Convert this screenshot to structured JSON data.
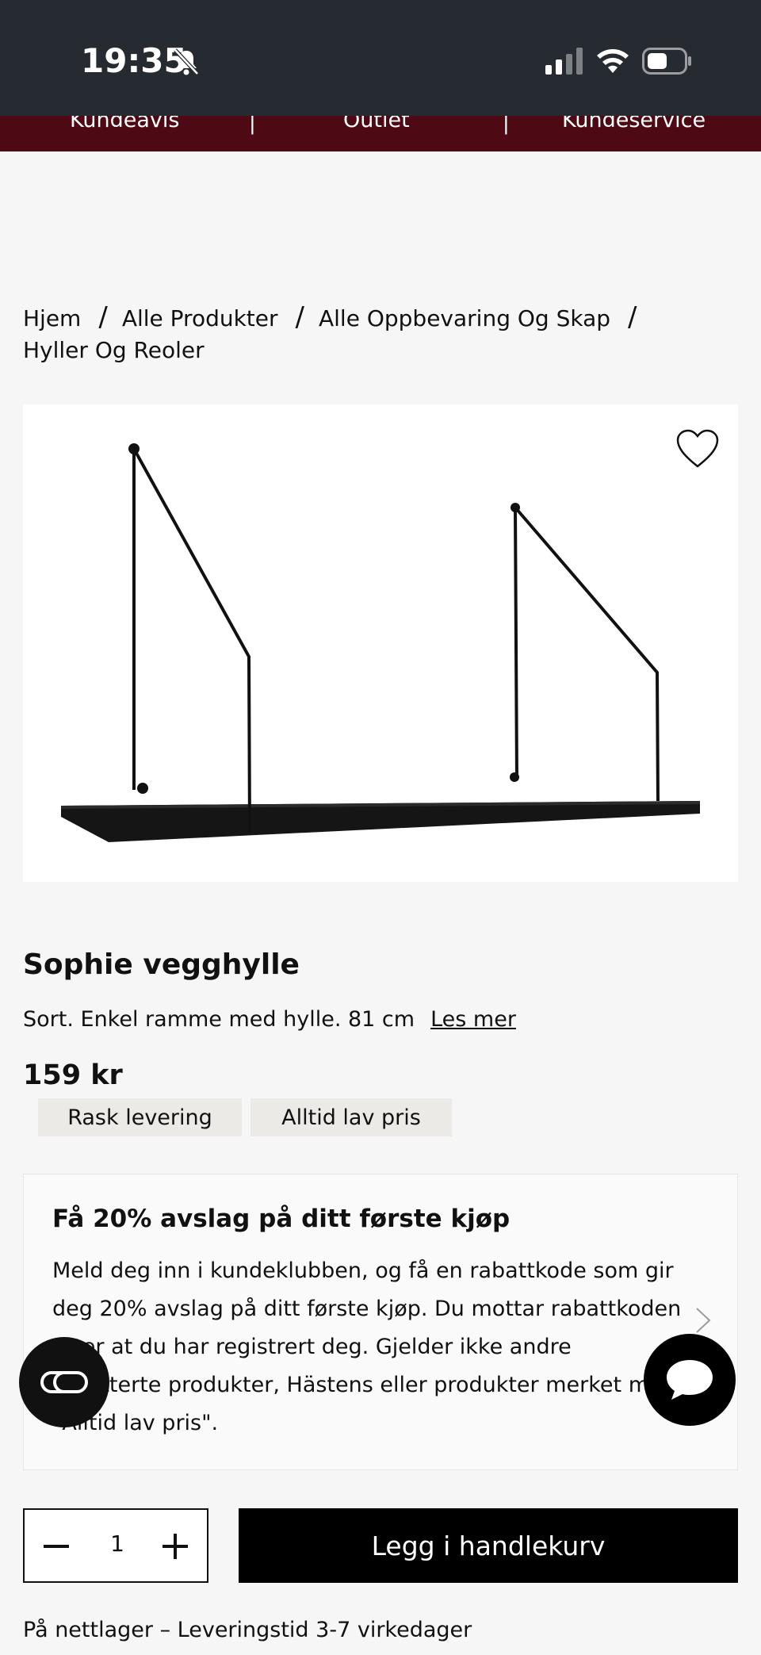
{
  "status_bar": {
    "time": "19:35"
  },
  "top_nav": {
    "items": [
      "Kundeavis",
      "Outlet",
      "Kundeservice"
    ]
  },
  "breadcrumb": {
    "items": [
      "Hjem",
      "Alle Produkter",
      "Alle Oppbevaring Og Skap",
      "Hyller Og Reoler"
    ],
    "separator": "/"
  },
  "product": {
    "title": "Sophie vegghylle",
    "description": "Sort. Enkel ramme med hylle. 81 cm",
    "read_more": "Les mer",
    "price": "159 kr",
    "badges": [
      "Rask levering",
      "Alltid lav pris"
    ]
  },
  "promo": {
    "title": "Få 20% avslag på ditt første kjøp",
    "body": "Meld deg inn i kundeklubben, og få en rabattkode som gir deg 20% avslag på ditt første kjøp. Du mottar rabattkoden etter at du har registrert deg. Gjelder ikke andre rabatterte produkter, Hästens eller produkter merket med \"Alltid lav pris\"."
  },
  "cart": {
    "quantity": "1",
    "add_label": "Legg i handlekurv"
  },
  "delivery": {
    "text": "På nettlager – Leveringstid 3-7 virkedager"
  },
  "colors": {
    "nav_bg": "#4d0a14",
    "status_bg": "#262a31",
    "button_bg": "#000000"
  }
}
